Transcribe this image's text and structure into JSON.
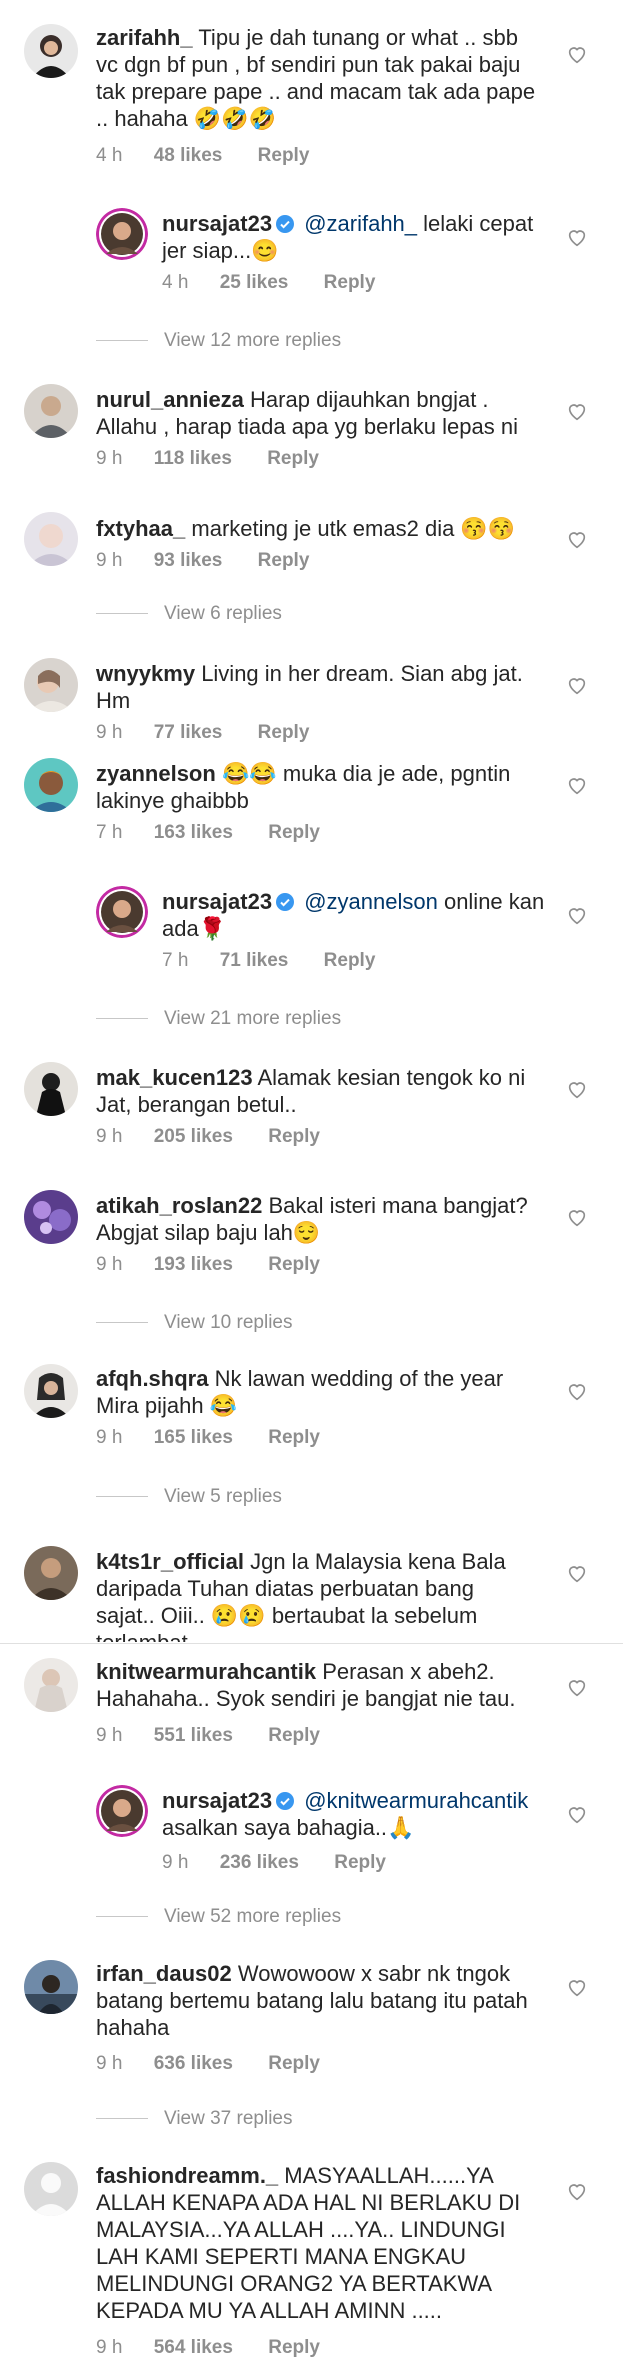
{
  "comments": [
    {
      "user": "zarifahh_",
      "text": "Tipu je dah tunang or what .. sbb vc dgn bf pun , bf sendiri pun tak pakai baju tak prepare pape .. and macam tak ada pape .. hahaha 🤣🤣🤣",
      "time": "4 h",
      "likes": "48 likes",
      "reply": "Reply"
    },
    {
      "user": "nursajat23",
      "mention": "@zarifahh_",
      "text": "lelaki cepat jer siap...😊",
      "time": "4 h",
      "likes": "25 likes",
      "reply": "Reply"
    },
    {
      "user": "nurul_annieza",
      "text": "Harap dijauhkan bngjat . Allahu , harap tiada apa yg berlaku lepas ni",
      "time": "9 h",
      "likes": "118 likes",
      "reply": "Reply"
    },
    {
      "user": "fxtyhaa_",
      "text": "marketing je utk emas2 dia 😚😚",
      "time": "9 h",
      "likes": "93 likes",
      "reply": "Reply"
    },
    {
      "user": "wnyykmy",
      "text": "Living in her dream. Sian abg jat. Hm",
      "time": "9 h",
      "likes": "77 likes",
      "reply": "Reply"
    },
    {
      "user": "zyannelson",
      "text": "😂😂 muka dia je ade, pgntin lakinye ghaibbb",
      "time": "7 h",
      "likes": "163 likes",
      "reply": "Reply"
    },
    {
      "user": "nursajat23",
      "mention": "@zyannelson",
      "text": "online kan ada🌹",
      "time": "7 h",
      "likes": "71 likes",
      "reply": "Reply"
    },
    {
      "user": "mak_kucen123",
      "text": "Alamak kesian tengok ko ni Jat, berangan betul..",
      "time": "9 h",
      "likes": "205 likes",
      "reply": "Reply"
    },
    {
      "user": "atikah_roslan22",
      "text": "Bakal isteri mana bangjat? Abgjat silap baju lah😌",
      "time": "9 h",
      "likes": "193 likes",
      "reply": "Reply"
    },
    {
      "user": "afqh.shqra",
      "text": "Nk lawan wedding of the year Mira pijahh 😂",
      "time": "9 h",
      "likes": "165 likes",
      "reply": "Reply"
    },
    {
      "user": "k4ts1r_official",
      "text": "Jgn la Malaysia kena Bala daripada Tuhan diatas perbuatan bang sajat.. Oiii.. 😢😢 bertaubat la sebelum terlambat"
    },
    {
      "user": "knitwearmurahcantik",
      "text": "Perasan x abeh2. Hahahaha.. Syok sendiri je bangjat nie tau.",
      "time": "9 h",
      "likes": "551 likes",
      "reply": "Reply"
    },
    {
      "user": "nursajat23",
      "mention": "@knitwearmurahcantik",
      "text": "asalkan saya bahagia..🙏",
      "time": "9 h",
      "likes": "236 likes",
      "reply": "Reply"
    },
    {
      "user": "irfan_daus02",
      "text": "Wowowoow x sabr nk tngok batang bertemu batang lalu batang itu patah hahaha",
      "time": "9 h",
      "likes": "636 likes",
      "reply": "Reply"
    },
    {
      "user": "fashiondreamm._",
      "text": "MASYAALLAH......YA ALLAH KENAPA ADA HAL NI BERLAKU DI MALAYSIA...YA ALLAH ....YA.. LINDUNGI LAH KAMI SEPERTI MANA ENGKAU MELINDUNGI ORANG2 YA BERTAKWA KEPADA MU YA ALLAH AMINN .....",
      "time": "9 h",
      "likes": "564 likes",
      "reply": "Reply"
    }
  ],
  "view_replies": [
    "View 12 more replies",
    "View 6 replies",
    "View 21 more replies",
    "View 10 replies",
    "View 5 replies",
    "View 52 more replies",
    "View 37 replies"
  ],
  "colors": {
    "text": "#262626",
    "muted": "#8e8e8e",
    "mention": "#00376b",
    "verified": "#3897f0"
  },
  "icons": {
    "like": "heart-outline-icon",
    "verified": "verified-badge-icon"
  }
}
